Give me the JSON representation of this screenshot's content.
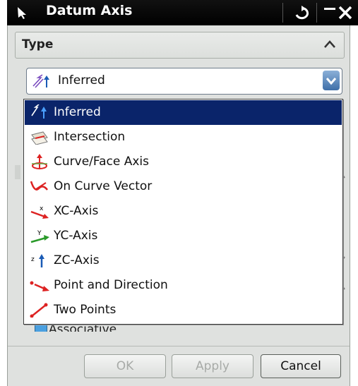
{
  "window": {
    "title": "Datum Axis"
  },
  "type_section": {
    "label": "Type"
  },
  "combo": {
    "value": "Inferred"
  },
  "options": [
    {
      "label": "Inferred",
      "icon": "inferred-icon",
      "selected": true
    },
    {
      "label": "Intersection",
      "icon": "intersection-icon"
    },
    {
      "label": "Curve/Face Axis",
      "icon": "curve-face-axis-icon"
    },
    {
      "label": "On Curve Vector",
      "icon": "on-curve-vector-icon"
    },
    {
      "label": "XC-Axis",
      "icon": "xc-axis-icon"
    },
    {
      "label": "YC-Axis",
      "icon": "yc-axis-icon"
    },
    {
      "label": "ZC-Axis",
      "icon": "zc-axis-icon"
    },
    {
      "label": "Point and Direction",
      "icon": "point-and-direction-icon"
    },
    {
      "label": "Two Points",
      "icon": "two-points-icon"
    }
  ],
  "settings": {
    "associative_label": "Associative"
  },
  "buttons": {
    "ok": "OK",
    "apply": "Apply",
    "cancel": "Cancel"
  },
  "colors": {
    "selection": "#0a246a",
    "panel": "#dfe1df",
    "titlebar": "#000000"
  }
}
